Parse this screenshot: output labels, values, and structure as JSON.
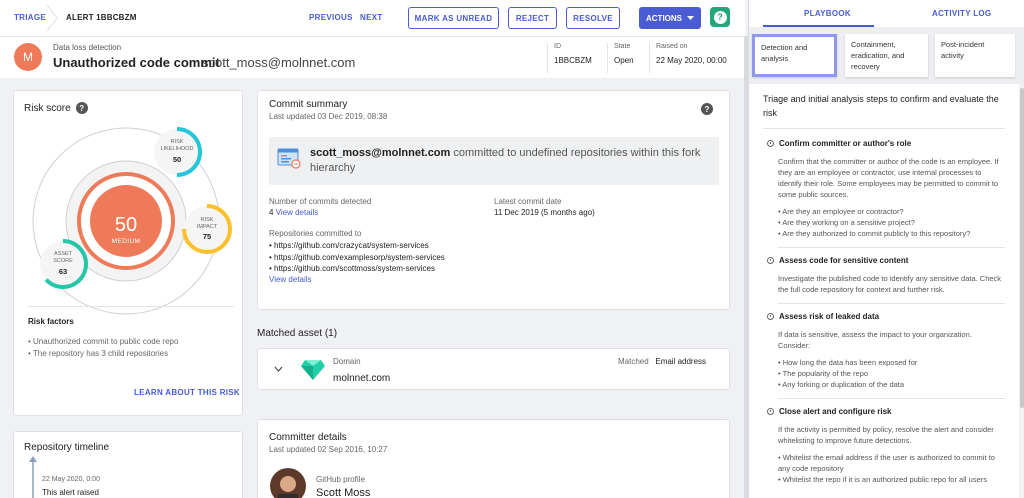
{
  "breadcrumb": {
    "root": "TRIAGE",
    "current": "ALERT 1BBCBZM"
  },
  "toolbar": {
    "previous": "PREVIOUS",
    "next": "NEXT",
    "mark_unread": "MARK AS UNREAD",
    "reject": "REJECT",
    "resolve": "RESOLVE",
    "actions": "ACTIONS",
    "help": "?"
  },
  "alert": {
    "avatar_letter": "M",
    "category": "Data loss detection",
    "title": "Unauthorized code commit",
    "email": "scott_moss@molnnet.com",
    "id_label": "ID",
    "id_value": "1BBCBZM",
    "state_label": "State",
    "state_value": "Open",
    "raised_label": "Raised on",
    "raised_value": "22 May 2020, 00:00"
  },
  "risk": {
    "title": "Risk score",
    "score": "50",
    "score_label": "MEDIUM",
    "likelihood_label_1": "RISK",
    "likelihood_label_2": "LIKELIHOOD",
    "likelihood_value": "50",
    "impact_label_1": "RISK",
    "impact_label_2": "IMPACT",
    "impact_value": "75",
    "asset_label_1": "ASSET",
    "asset_label_2": "SCORE",
    "asset_value": "63",
    "factors_title": "Risk factors",
    "factors": [
      "Unauthorized commit to public code repo",
      "The repository has 3 child repositories"
    ],
    "learn_more": "LEARN ABOUT THIS RISK",
    "colors": {
      "score": "#ef7a59",
      "likelihood": "#26c6da",
      "impact": "#fbc02d",
      "asset": "#26c6a8"
    }
  },
  "timeline": {
    "title": "Repository timeline",
    "date": "22 May 2020, 0:00",
    "event": "This alert raised"
  },
  "commit": {
    "title": "Commit summary",
    "updated": "Last updated 03 Dec 2019, 08:38",
    "banner_user": "scott_moss@molnnet.com",
    "banner_rest": " committed to undefined repositories within this fork hierarchy",
    "commits_label": "Number of commits detected",
    "commits_value": "4",
    "view_details": "View details",
    "latest_label": "Latest commit date",
    "latest_value": "11 Dec 2019 (5 months ago)",
    "repos_label": "Repositories committed to",
    "repos": [
      "https://github.com/crazycat/system-services",
      "https://github.com/examplesorp/system-services",
      "https://github.com/scottmoss/system-services"
    ],
    "repos_view_details": "View details"
  },
  "matched": {
    "title": "Matched asset (1)",
    "type_label": "Domain",
    "domain": "molnnet.com",
    "matched_label": "Matched",
    "matched_value": "Email address"
  },
  "committer": {
    "title": "Committer details",
    "updated": "Last updated 02 Sep 2016, 10:27",
    "profile_label": "GitHub profile",
    "name": "Scott Moss"
  },
  "playbook": {
    "tabs": [
      "PLAYBOOK",
      "ACTIVITY LOG"
    ],
    "subtabs": [
      "Detection and analysis",
      "Containment, eradication, and recovery",
      "Post-incident activity"
    ],
    "intro": "Triage and initial analysis steps to confirm and evaluate the risk",
    "sections": [
      {
        "title": "Confirm committer or author's role",
        "body": "Confirm that the committer or author of the code is an employee. If they are an employee or contractor, use internal processes to identify their role. Some employees may be permitted to commit to some public sources.",
        "items": [
          "Are they an employee or contractor?",
          "Are they working on a sensitive project?",
          "Are they authorized to commit publicly to this repository?"
        ]
      },
      {
        "title": "Assess code for sensitive content",
        "body": "Investigate the published code to identify any sensitive data. Check the full code repository for context and further risk.",
        "items": []
      },
      {
        "title": "Assess risk of leaked data",
        "body": "If data is sensitive, assess the impact to your organization. Consider:",
        "items": [
          "How long the data has been exposed for",
          "The popularity of the repo",
          "Any forking or duplication of the data"
        ]
      },
      {
        "title": "Close alert and configure risk",
        "body": "If the activity is permitted by policy, resolve the alert and consider whitelisting to improve future detections.",
        "items": [
          "Whitelist the email address if the user is authorized to commit to any code repository",
          "Whitelist the repo if it is an authorized public repo for all users"
        ]
      }
    ]
  }
}
